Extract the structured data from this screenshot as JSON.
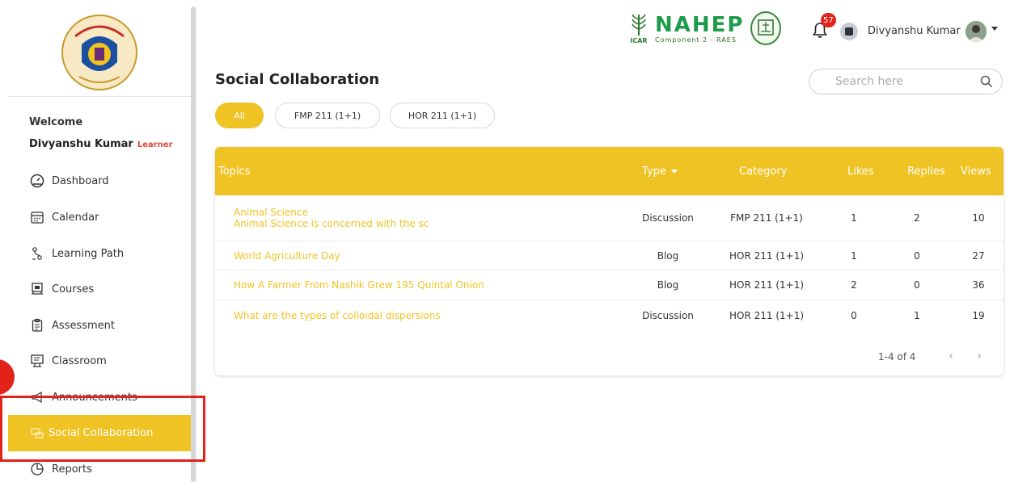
{
  "sidebar": {
    "welcome": "Welcome",
    "user_name": "Divyanshu Kumar",
    "role": "Learner",
    "items": [
      {
        "label": "Dashboard",
        "icon": "speedometer-icon"
      },
      {
        "label": "Calendar",
        "icon": "calendar-icon"
      },
      {
        "label": "Learning Path",
        "icon": "path-icon"
      },
      {
        "label": "Courses",
        "icon": "courses-icon"
      },
      {
        "label": "Assessment",
        "icon": "clipboard-icon"
      },
      {
        "label": "Classroom",
        "icon": "classroom-icon"
      },
      {
        "label": "Announcements",
        "icon": "megaphone-icon"
      },
      {
        "label": "Social Collaboration",
        "icon": "chat-icon",
        "active": true
      },
      {
        "label": "Reports",
        "icon": "pie-chart-icon"
      }
    ]
  },
  "header": {
    "brand_word": "NAHEP",
    "brand_sub": "Component 2 - RAES",
    "icar": "ICAR",
    "notification_count": "57",
    "user_name": "Divyanshu Kumar"
  },
  "page": {
    "title": "Social Collaboration",
    "search_placeholder": "Search here"
  },
  "filters": [
    "All",
    "FMP 211 (1+1)",
    "HOR 211 (1+1)"
  ],
  "table": {
    "headers": {
      "topics": "Topics",
      "type": "Type",
      "category": "Category",
      "likes": "Likes",
      "replies": "Replies",
      "views": "Views"
    },
    "rows": [
      {
        "title": "Animal Science",
        "subtitle": "Animal Science is concerned with the sc",
        "type": "Discussion",
        "category": "FMP 211 (1+1)",
        "likes": "1",
        "replies": "2",
        "views": "10"
      },
      {
        "title": "World Agriculture Day",
        "subtitle": "",
        "type": "Blog",
        "category": "HOR 211 (1+1)",
        "likes": "1",
        "replies": "0",
        "views": "27"
      },
      {
        "title": "How A Farmer From Nashik Grew 195 Quintal Onion",
        "subtitle": "",
        "type": "Blog",
        "category": "HOR 211 (1+1)",
        "likes": "2",
        "replies": "0",
        "views": "36"
      },
      {
        "title": "What are the types of colloidal dispersions",
        "subtitle": "",
        "type": "Discussion",
        "category": "HOR 211 (1+1)",
        "likes": "0",
        "replies": "1",
        "views": "19"
      }
    ],
    "pagination": "1-4 of 4"
  },
  "colors": {
    "accent": "#f0c324",
    "highlight": "#e2231a",
    "badge": "#e2231a"
  }
}
